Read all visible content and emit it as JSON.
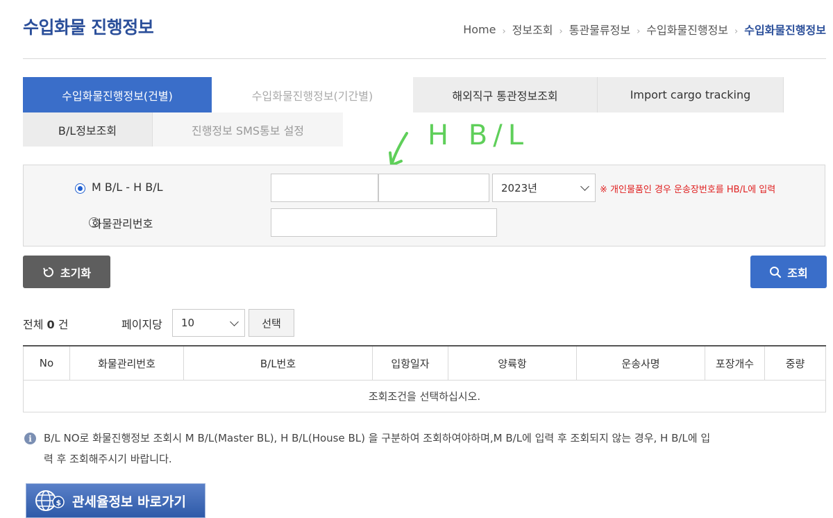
{
  "page_title": "수입화물 진행정보",
  "breadcrumb": [
    "Home",
    "정보조회",
    "통관물류정보",
    "수입화물진행정보",
    "수입화물진행정보"
  ],
  "tabs": [
    {
      "label": "수입화물진행정보(건별)"
    },
    {
      "label": "수입화물진행정보(기간별)"
    },
    {
      "label": "해외직구 통관정보조회"
    },
    {
      "label": "Import cargo tracking"
    }
  ],
  "subtabs": [
    {
      "label": "B/L정보조회"
    },
    {
      "label": "진행정보 SMS통보 설정"
    }
  ],
  "search": {
    "option_bl_label": "M B/L - H B/L",
    "option_cargo_label": "화물관리번호",
    "year_value": "2023년",
    "note": "※ 개인물품인 경우 운송장번호를 HB/L에 입력"
  },
  "annotation": {
    "text": "H B/L",
    "color": "#5fcf5a"
  },
  "buttons": {
    "reset": "초기화",
    "search": "조회",
    "choose": "선택"
  },
  "list": {
    "total_prefix": "전체",
    "total_count": "0",
    "total_suffix": "건",
    "per_page_label": "페이지당",
    "per_page_value": "10"
  },
  "table": {
    "columns": [
      "No",
      "화물관리번호",
      "B/L번호",
      "입항일자",
      "양륙항",
      "운송사명",
      "포장개수",
      "중량"
    ],
    "empty_message": "조회조건을 선택하십시오."
  },
  "info": {
    "line1": "B/L NO로 화물진행정보 조회시 M B/L(Master BL), H B/L(House BL) 을 구분하여 조회하여야하며,M B/L에 입력 후 조회되지 않는 경우, H B/L에 입",
    "line2": "력 후 조회해주시기 바랍니다."
  },
  "banner": {
    "label": "관세율정보 바로가기"
  },
  "colors": {
    "accent": "#3a6ec9",
    "title": "#2b4f9a",
    "note": "#e02020"
  }
}
